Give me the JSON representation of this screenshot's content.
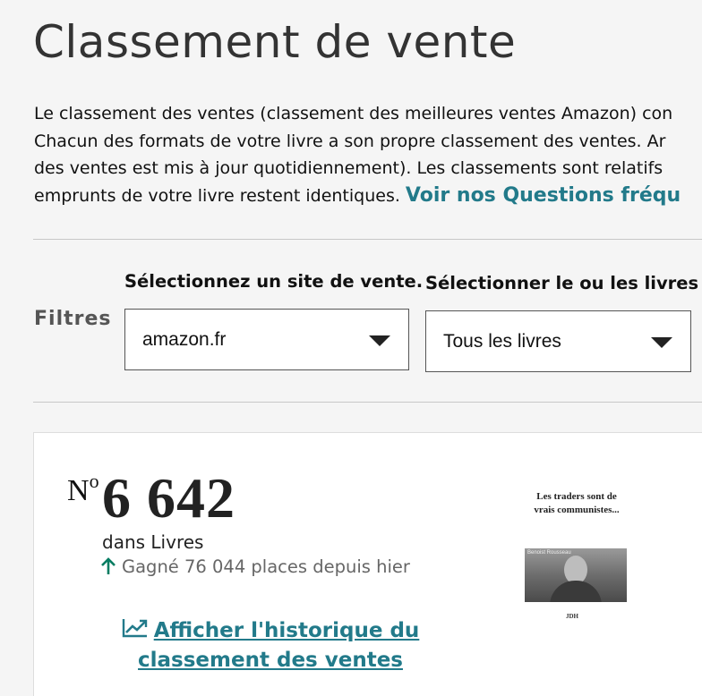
{
  "page": {
    "title": "Classement de vente"
  },
  "intro": {
    "line1": "Le classement des ventes (classement des meilleures ventes Amazon) con",
    "line2": "Chacun des formats de votre livre a son propre classement des ventes. Ar",
    "line3": "des ventes est mis à jour quotidiennement). Les classements sont relatifs",
    "line4": "emprunts de votre livre restent identiques. ",
    "faq_link": "Voir nos Questions fréqu"
  },
  "filters": {
    "label": "Filtres",
    "site": {
      "heading": "Sélectionnez un site de vente.",
      "value": "amazon.fr"
    },
    "books": {
      "heading": "Sélectionner le ou les livres",
      "value": "Tous les livres"
    }
  },
  "rank_card": {
    "prefix": "N",
    "prefix_sup": "o",
    "rank": "6 642",
    "category": "dans Livres",
    "change": "Gagné 76 044 places depuis hier",
    "history_link": "Afficher l'historique du classement des ventes",
    "cover": {
      "title_line1": "Les traders sont de",
      "title_line2": "vrais communistes...",
      "author": "Benoist Rousseau",
      "publisher": "JDH"
    },
    "colors": {
      "up_arrow": "#067d62",
      "link": "#227a8a"
    }
  }
}
